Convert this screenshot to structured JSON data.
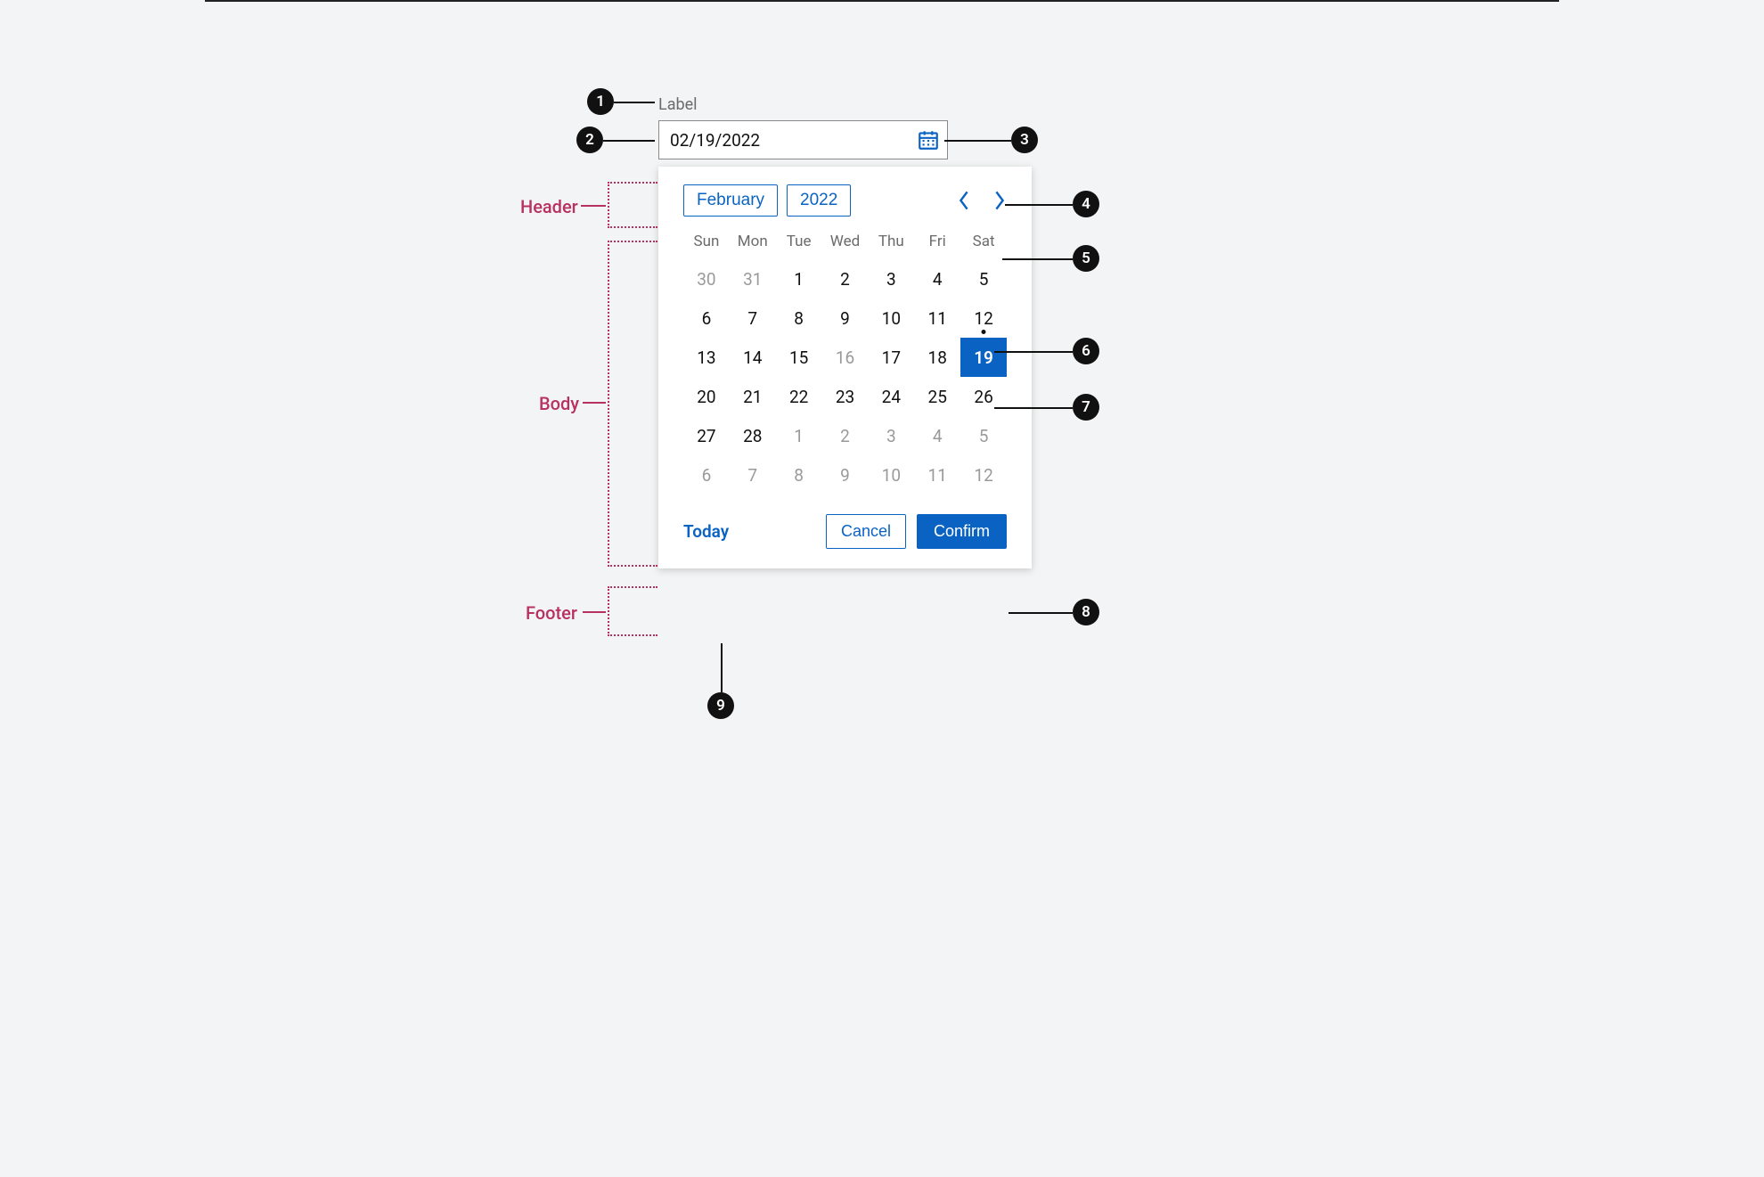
{
  "field": {
    "label": "Label",
    "value": "02/19/2022"
  },
  "calendar": {
    "month_label": "February",
    "year_label": "2022",
    "weekdays": [
      "Sun",
      "Mon",
      "Tue",
      "Wed",
      "Thu",
      "Fri",
      "Sat"
    ],
    "rows": [
      [
        {
          "n": "30",
          "muted": true
        },
        {
          "n": "31",
          "muted": true
        },
        {
          "n": "1"
        },
        {
          "n": "2"
        },
        {
          "n": "3"
        },
        {
          "n": "4"
        },
        {
          "n": "5"
        }
      ],
      [
        {
          "n": "6"
        },
        {
          "n": "7"
        },
        {
          "n": "8"
        },
        {
          "n": "9"
        },
        {
          "n": "10"
        },
        {
          "n": "11"
        },
        {
          "n": "12",
          "today": true
        }
      ],
      [
        {
          "n": "13"
        },
        {
          "n": "14"
        },
        {
          "n": "15"
        },
        {
          "n": "16",
          "muted": true
        },
        {
          "n": "17"
        },
        {
          "n": "18"
        },
        {
          "n": "19",
          "selected": true
        }
      ],
      [
        {
          "n": "20"
        },
        {
          "n": "21"
        },
        {
          "n": "22"
        },
        {
          "n": "23"
        },
        {
          "n": "24"
        },
        {
          "n": "25"
        },
        {
          "n": "26"
        }
      ],
      [
        {
          "n": "27"
        },
        {
          "n": "28"
        },
        {
          "n": "1",
          "muted": true
        },
        {
          "n": "2",
          "muted": true
        },
        {
          "n": "3",
          "muted": true
        },
        {
          "n": "4",
          "muted": true
        },
        {
          "n": "5",
          "muted": true
        }
      ],
      [
        {
          "n": "6",
          "muted": true
        },
        {
          "n": "7",
          "muted": true
        },
        {
          "n": "8",
          "muted": true
        },
        {
          "n": "9",
          "muted": true
        },
        {
          "n": "10",
          "muted": true
        },
        {
          "n": "11",
          "muted": true
        },
        {
          "n": "12",
          "muted": true
        }
      ]
    ],
    "footer": {
      "today": "Today",
      "cancel": "Cancel",
      "confirm": "Confirm"
    }
  },
  "annotations": {
    "section_header": "Header",
    "section_body": "Body",
    "section_footer": "Footer",
    "pins": [
      "1",
      "2",
      "3",
      "4",
      "5",
      "6",
      "7",
      "8",
      "9"
    ]
  }
}
